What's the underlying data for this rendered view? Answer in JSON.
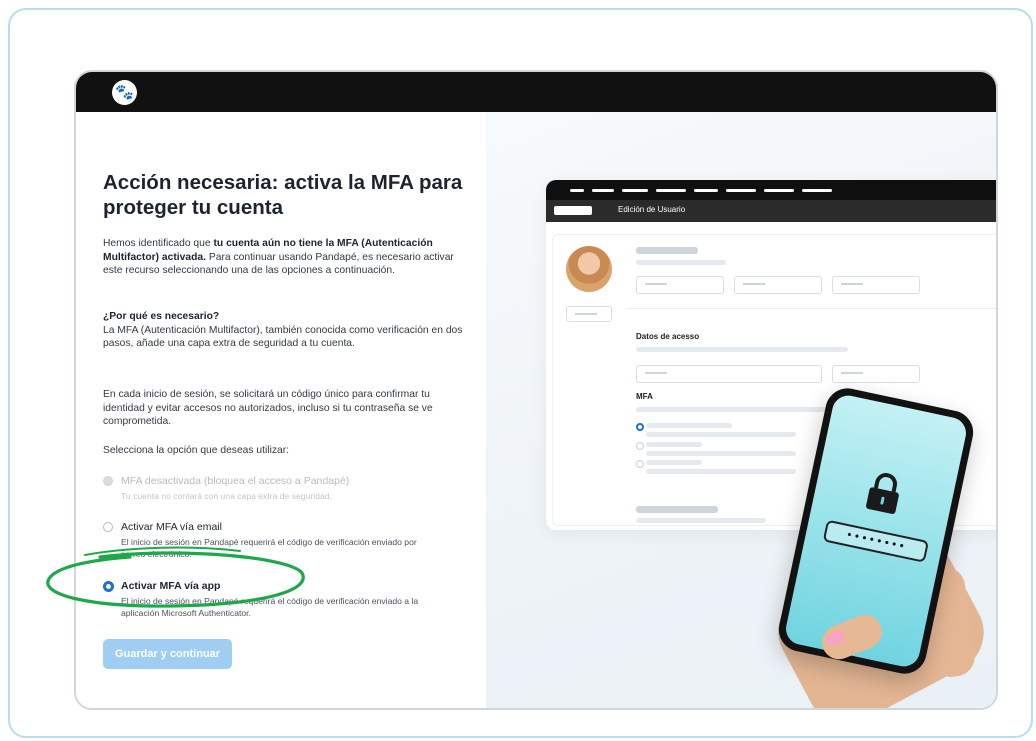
{
  "left_panel": {
    "title": "Acción necesaria: activa la MFA para proteger tu cuenta",
    "intro_1": "Hemos identificado que ",
    "intro_bold": "tu cuenta aún no tiene la MFA (Autenticación Multifactor) activada.",
    "intro_2": " Para continuar usando Pandapé, es necesario activar este recurso seleccionando una de las opciones a continuación.",
    "why_heading": "¿Por qué es necesario?",
    "why_text": "La MFA (Autenticación Multifactor), también conocida como verificación en dos pasos, añade una capa extra de seguridad a tu cuenta.",
    "login_text": "En cada inicio de sesión, se solicitará un código único para confirmar tu identidad y evitar accesos no autorizados, incluso si tu contraseña se ve comprometida.",
    "select_prompt": "Selecciona la opción que deseas utilizar:",
    "options": [
      {
        "title": "MFA desactivada (bloquea el acceso a Pandapé)",
        "desc": "Tu cuenta no contará con una capa extra de seguridad.",
        "state": "disabled"
      },
      {
        "title": "Activar MFA vía email",
        "desc": "El inicio de sesión en Pandapé requerirá el código de verificación enviado por correo electrónico.",
        "state": "unchecked"
      },
      {
        "title": "Activar MFA vía app",
        "desc": "El inicio de sesión en Pandapé requerirá el código de verificación enviado a la aplicación Microsoft Authenticator.",
        "state": "checked"
      }
    ],
    "save_button": "Guardar y continuar"
  },
  "mockup": {
    "subheader": "Edición de Usuario",
    "access_label": "Datos de acesso",
    "mfa_label": "MFA",
    "password_mask": "••••••••"
  },
  "icons": {
    "logo": "paw-icon",
    "lock": "lock-icon"
  },
  "colors": {
    "primary": "#1e6fd1",
    "button_disabled": "#9fcdf3",
    "annotation": "#1fa84a",
    "topbar": "#111111"
  }
}
